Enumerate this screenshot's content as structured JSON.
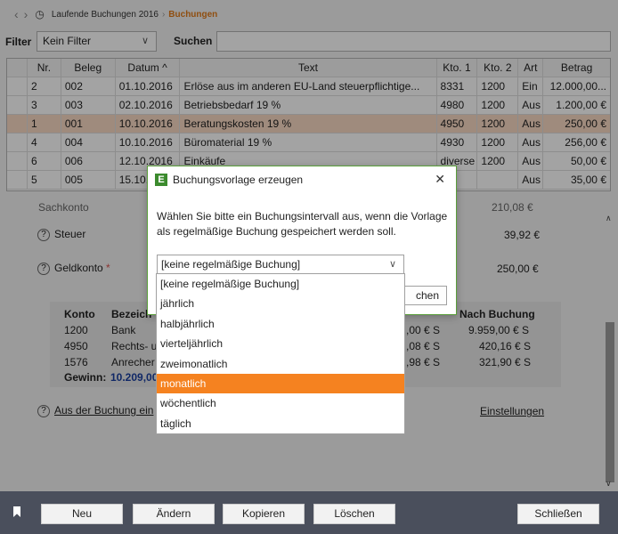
{
  "breadcrumb": {
    "back": "‹",
    "forward": "›",
    "history": "◷",
    "items": [
      "Laufende Buchungen 2016",
      "Buchungen"
    ],
    "sep": "›"
  },
  "filter": {
    "label": "Filter",
    "value": "Kein Filter"
  },
  "search": {
    "label": "Suchen",
    "value": ""
  },
  "table": {
    "headers": [
      "",
      "Nr.",
      "Beleg",
      "Datum",
      "Text",
      "Kto. 1",
      "Kto. 2",
      "Art",
      "Betrag"
    ],
    "rows": [
      [
        "",
        "2",
        "002",
        "01.10.2016",
        "Erlöse aus im anderen EU-Land steuerpflichtige...",
        "8331",
        "1200",
        "Ein",
        "12.000,00..."
      ],
      [
        "",
        "3",
        "003",
        "02.10.2016",
        "Betriebsbedarf 19 %",
        "4980",
        "1200",
        "Aus",
        "1.200,00 €"
      ],
      [
        "",
        "1",
        "001",
        "10.10.2016",
        "Beratungskosten 19 %",
        "4950",
        "1200",
        "Aus",
        "250,00 €"
      ],
      [
        "",
        "4",
        "004",
        "10.10.2016",
        "Büromaterial 19 %",
        "4930",
        "1200",
        "Aus",
        "256,00 €"
      ],
      [
        "",
        "6",
        "006",
        "12.10.2016",
        "Einkäufe",
        "diverse",
        "1200",
        "Aus",
        "50,00 €"
      ],
      [
        "",
        "5",
        "005",
        "15.10.",
        "",
        "",
        "",
        "Aus",
        "35,00 €"
      ]
    ],
    "sort_icon": "^"
  },
  "form": {
    "sachkonto_label": "Sachkonto",
    "sachkonto_value": "210,08 €",
    "steuer_label": "Steuer",
    "steuer_value": "39,92 €",
    "geldkonto_label": "Geldkonto",
    "geldkonto_req": "*",
    "geldkonto_value": "250,00 €",
    "konto_headers": [
      "Konto",
      "Bezeich",
      "Nach Buchung"
    ],
    "konto_rows": [
      [
        "1200",
        "Bank",
        ",00 €  S",
        "9.959,00 € S"
      ],
      [
        "4950",
        "Rechts- u",
        ",08 €  S",
        "420,16 € S"
      ],
      [
        "1576",
        "Anrecher",
        ",98 €  S",
        "321,90 € S"
      ]
    ],
    "gewinn_label": "Gewinn:",
    "gewinn_value": "10.209,00",
    "link_text": "Aus der Buchung ein",
    "settings_link": "Einstellungen"
  },
  "bottom": {
    "buttons": [
      "Neu",
      "Ändern",
      "Kopieren",
      "Löschen",
      "Schließen"
    ]
  },
  "dialog": {
    "title": "Buchungsvorlage erzeugen",
    "logo": "E",
    "close": "✕",
    "message": "Wählen Sie bitte ein Buchungsintervall aus, wenn die Vorlage als regelmäßige Buchung gespeichert werden soll.",
    "select_value": "[keine regelmäßige Buchung]",
    "button_partial": "chen"
  },
  "dropdown": {
    "options": [
      "[keine regelmäßige Buchung]",
      "jährlich",
      "halbjährlich",
      "vierteljährlich",
      "zweimonatlich",
      "monatlich",
      "wöchentlich",
      "täglich"
    ],
    "highlighted": "monatlich"
  },
  "colors": {
    "accent": "#f58220",
    "selected_row": "#f9d9c4",
    "bottom_bar": "#4a4f5c",
    "dialog_border": "#5a9e3a"
  }
}
